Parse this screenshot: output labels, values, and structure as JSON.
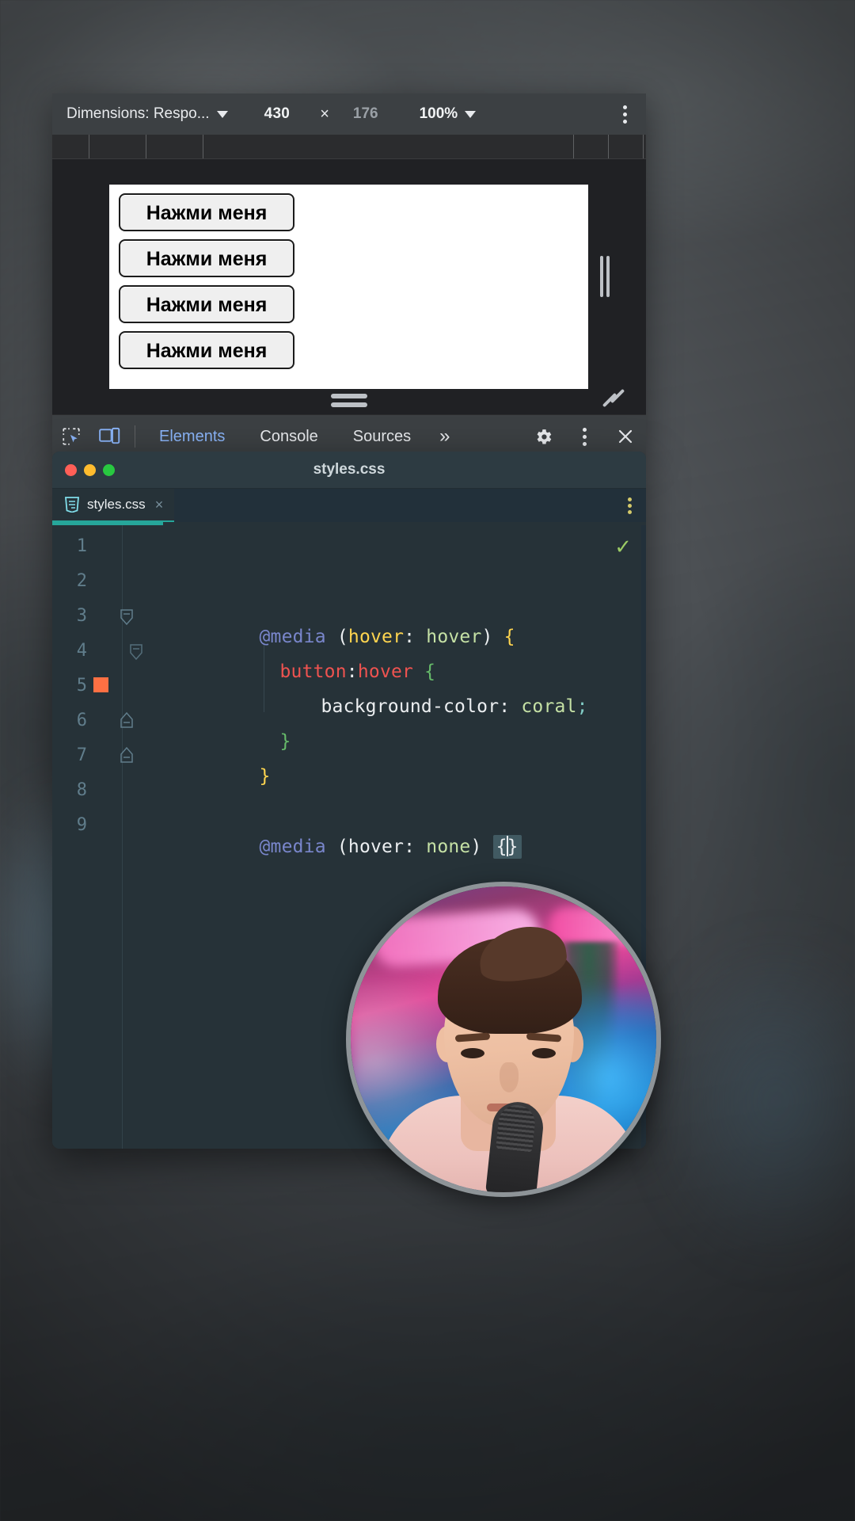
{
  "device_toolbar": {
    "dimensions_label": "Dimensions: Respo...",
    "dimensions_caret": "caret-down-icon",
    "width_value": "430",
    "separator": "×",
    "height_value": "176",
    "zoom_value": "100%",
    "zoom_caret": "caret-down-icon",
    "more_options": "kebab-menu-icon"
  },
  "viewport": {
    "buttons": [
      {
        "label": "Нажми меня"
      },
      {
        "label": "Нажми меня"
      },
      {
        "label": "Нажми меня"
      },
      {
        "label": "Нажми меня"
      }
    ],
    "handles": {
      "right": "resize-handle-horizontal",
      "bottom": "resize-handle-vertical",
      "corner": "resize-handle-corner"
    }
  },
  "devtools_tabbar": {
    "inspect_icon": "inspect-element-icon",
    "device_icon": "toggle-device-toolbar-icon",
    "tabs": [
      {
        "label": "Elements",
        "active": true
      },
      {
        "label": "Console",
        "active": false
      },
      {
        "label": "Sources",
        "active": false
      }
    ],
    "more_tabs": "»",
    "settings_icon": "gear-icon",
    "kebab_icon": "kebab-menu-icon",
    "close_icon": "close-icon"
  },
  "editor": {
    "window_title": "styles.css",
    "traffic_lights": {
      "close": "#ff5f57",
      "minimize": "#febc2e",
      "zoom": "#28c840"
    },
    "file_tab": {
      "icon": "css3-file-icon",
      "name": "styles.css",
      "close": "×"
    },
    "tab_kebab": "kebab-menu-icon",
    "status_check": "✓",
    "accent_color": "#26a69a",
    "lines": [
      {
        "n": "1",
        "tokens": []
      },
      {
        "n": "2",
        "tokens": []
      },
      {
        "n": "3",
        "fold": "open",
        "tokens": [
          {
            "t": "@media",
            "c": "at"
          },
          {
            "t": " ",
            "c": "white"
          },
          {
            "t": "(",
            "c": "paren"
          },
          {
            "t": "hover",
            "c": "prop"
          },
          {
            "t": ": ",
            "c": "white"
          },
          {
            "t": "hover",
            "c": "val"
          },
          {
            "t": ")",
            "c": "paren"
          },
          {
            "t": " ",
            "c": "white"
          },
          {
            "t": "{",
            "c": "brace"
          }
        ]
      },
      {
        "n": "4",
        "fold": "open",
        "indent": 1,
        "tokens": [
          {
            "t": "button",
            "c": "sel"
          },
          {
            "t": ":",
            "c": "white"
          },
          {
            "t": "hover",
            "c": "pseudo"
          },
          {
            "t": " ",
            "c": "white"
          },
          {
            "t": "{",
            "c": "brace2"
          }
        ]
      },
      {
        "n": "5",
        "swatch": "#ff7043",
        "indent": 2,
        "tokens": [
          {
            "t": "background-color",
            "c": "decl"
          },
          {
            "t": ": ",
            "c": "white"
          },
          {
            "t": "coral",
            "c": "coral"
          },
          {
            "t": ";",
            "c": "semi"
          }
        ]
      },
      {
        "n": "6",
        "fold": "close",
        "indent": 1,
        "tokens": [
          {
            "t": "}",
            "c": "brace2"
          }
        ]
      },
      {
        "n": "7",
        "fold": "close",
        "tokens": [
          {
            "t": "}",
            "c": "brace"
          }
        ]
      },
      {
        "n": "8",
        "tokens": []
      },
      {
        "n": "9",
        "tokens": [
          {
            "t": "@media",
            "c": "at"
          },
          {
            "t": " ",
            "c": "white"
          },
          {
            "t": "(",
            "c": "paren"
          },
          {
            "t": "hover",
            "c": "white"
          },
          {
            "t": ": ",
            "c": "white"
          },
          {
            "t": "none",
            "c": "val"
          },
          {
            "t": ")",
            "c": "paren"
          },
          {
            "t": " ",
            "c": "white"
          }
        ],
        "widget": {
          "open": "{",
          "close": "}",
          "has_caret": true
        }
      }
    ]
  },
  "webcam": {
    "label": "presenter-webcam-overlay"
  }
}
